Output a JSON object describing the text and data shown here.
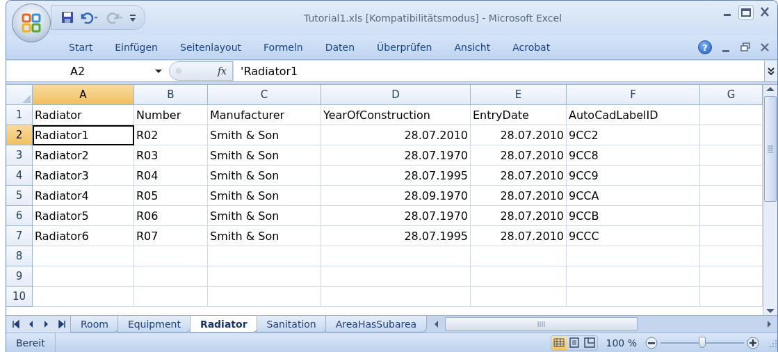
{
  "window": {
    "title": "Tutorial1.xls  [Kompatibilitätsmodus] - Microsoft Excel"
  },
  "ribbon_tabs": [
    {
      "label": "Start",
      "selected": false
    },
    {
      "label": "Einfügen",
      "selected": false
    },
    {
      "label": "Seitenlayout",
      "selected": false
    },
    {
      "label": "Formeln",
      "selected": false
    },
    {
      "label": "Daten",
      "selected": false
    },
    {
      "label": "Überprüfen",
      "selected": false
    },
    {
      "label": "Ansicht",
      "selected": false
    },
    {
      "label": "Acrobat",
      "selected": false
    }
  ],
  "help_button": "?",
  "formula_bar": {
    "name_box": "A2",
    "function_button": "fx",
    "formula": "'Radiator1"
  },
  "columns": [
    {
      "label": "A",
      "selected": true
    },
    {
      "label": "B",
      "selected": false
    },
    {
      "label": "C",
      "selected": false
    },
    {
      "label": "D",
      "selected": false,
      "kind": "date"
    },
    {
      "label": "E",
      "selected": false,
      "kind": "date"
    },
    {
      "label": "F",
      "selected": false
    },
    {
      "label": "G",
      "selected": false
    }
  ],
  "rows": [
    {
      "number": "1",
      "selected": false,
      "kind": "header",
      "cells": [
        "Radiator",
        "Number",
        "Manufacturer",
        "YearOfConstruction",
        "EntryDate",
        "AutoCadLabelID"
      ]
    },
    {
      "number": "2",
      "selected": true,
      "kind": "data",
      "cells": [
        "Radiator1",
        "R02",
        "Smith & Son",
        "28.07.2010",
        "28.07.2010",
        "9CC2"
      ]
    },
    {
      "number": "3",
      "selected": false,
      "kind": "data",
      "cells": [
        "Radiator2",
        "R03",
        "Smith & Son",
        "28.07.1970",
        "28.07.2010",
        "9CC8"
      ]
    },
    {
      "number": "4",
      "selected": false,
      "kind": "data",
      "cells": [
        "Radiator3",
        "R04",
        "Smith & Son",
        "28.07.1995",
        "28.07.2010",
        "9CC9"
      ]
    },
    {
      "number": "5",
      "selected": false,
      "kind": "data",
      "cells": [
        "Radiator4",
        "R05",
        "Smith & Son",
        "28.09.1970",
        "28.07.2010",
        "9CCA"
      ]
    },
    {
      "number": "6",
      "selected": false,
      "kind": "data",
      "cells": [
        "Radiator5",
        "R06",
        "Smith & Son",
        "28.07.1970",
        "28.07.2010",
        "9CCB"
      ]
    },
    {
      "number": "7",
      "selected": false,
      "kind": "data",
      "cells": [
        "Radiator6",
        "R07",
        "Smith & Son",
        "28.07.1995",
        "28.07.2010",
        "9CCC"
      ]
    },
    {
      "number": "8",
      "selected": false,
      "kind": "data",
      "cells": []
    },
    {
      "number": "9",
      "selected": false,
      "kind": "data",
      "cells": []
    },
    {
      "number": "10",
      "selected": false,
      "kind": "data",
      "cells": []
    }
  ],
  "sheet_tabs": [
    {
      "label": "Room",
      "selected": false
    },
    {
      "label": "Equipment",
      "selected": false
    },
    {
      "label": "Radiator",
      "selected": true
    },
    {
      "label": "Sanitation",
      "selected": false
    },
    {
      "label": "AreaHasSubarea",
      "selected": false
    }
  ],
  "status_bar": {
    "status": "Bereit",
    "views": [
      {
        "kind": "normal",
        "selected": true
      },
      {
        "kind": "page-layout",
        "selected": false
      },
      {
        "kind": "page-break",
        "selected": false
      }
    ],
    "zoom": "100 %",
    "zoom_slider": {
      "level": 0.5
    }
  }
}
